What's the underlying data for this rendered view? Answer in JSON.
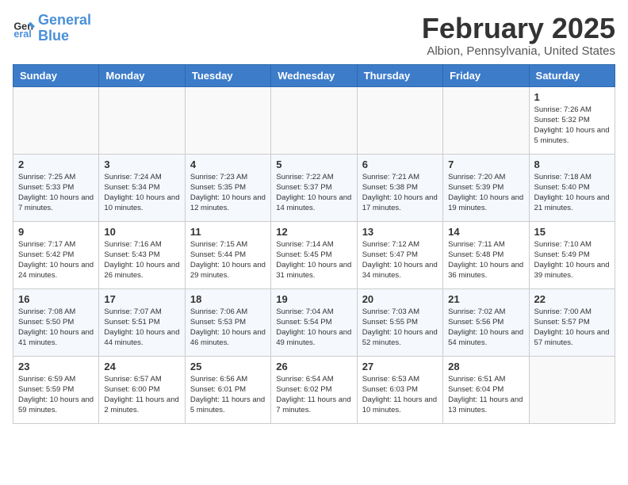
{
  "logo": {
    "line1": "General",
    "line2": "Blue"
  },
  "title": "February 2025",
  "subtitle": "Albion, Pennsylvania, United States",
  "days_of_week": [
    "Sunday",
    "Monday",
    "Tuesday",
    "Wednesday",
    "Thursday",
    "Friday",
    "Saturday"
  ],
  "weeks": [
    [
      {
        "day": "",
        "info": ""
      },
      {
        "day": "",
        "info": ""
      },
      {
        "day": "",
        "info": ""
      },
      {
        "day": "",
        "info": ""
      },
      {
        "day": "",
        "info": ""
      },
      {
        "day": "",
        "info": ""
      },
      {
        "day": "1",
        "info": "Sunrise: 7:26 AM\nSunset: 5:32 PM\nDaylight: 10 hours\nand 5 minutes."
      }
    ],
    [
      {
        "day": "2",
        "info": "Sunrise: 7:25 AM\nSunset: 5:33 PM\nDaylight: 10 hours\nand 7 minutes."
      },
      {
        "day": "3",
        "info": "Sunrise: 7:24 AM\nSunset: 5:34 PM\nDaylight: 10 hours\nand 10 minutes."
      },
      {
        "day": "4",
        "info": "Sunrise: 7:23 AM\nSunset: 5:35 PM\nDaylight: 10 hours\nand 12 minutes."
      },
      {
        "day": "5",
        "info": "Sunrise: 7:22 AM\nSunset: 5:37 PM\nDaylight: 10 hours\nand 14 minutes."
      },
      {
        "day": "6",
        "info": "Sunrise: 7:21 AM\nSunset: 5:38 PM\nDaylight: 10 hours\nand 17 minutes."
      },
      {
        "day": "7",
        "info": "Sunrise: 7:20 AM\nSunset: 5:39 PM\nDaylight: 10 hours\nand 19 minutes."
      },
      {
        "day": "8",
        "info": "Sunrise: 7:18 AM\nSunset: 5:40 PM\nDaylight: 10 hours\nand 21 minutes."
      }
    ],
    [
      {
        "day": "9",
        "info": "Sunrise: 7:17 AM\nSunset: 5:42 PM\nDaylight: 10 hours\nand 24 minutes."
      },
      {
        "day": "10",
        "info": "Sunrise: 7:16 AM\nSunset: 5:43 PM\nDaylight: 10 hours\nand 26 minutes."
      },
      {
        "day": "11",
        "info": "Sunrise: 7:15 AM\nSunset: 5:44 PM\nDaylight: 10 hours\nand 29 minutes."
      },
      {
        "day": "12",
        "info": "Sunrise: 7:14 AM\nSunset: 5:45 PM\nDaylight: 10 hours\nand 31 minutes."
      },
      {
        "day": "13",
        "info": "Sunrise: 7:12 AM\nSunset: 5:47 PM\nDaylight: 10 hours\nand 34 minutes."
      },
      {
        "day": "14",
        "info": "Sunrise: 7:11 AM\nSunset: 5:48 PM\nDaylight: 10 hours\nand 36 minutes."
      },
      {
        "day": "15",
        "info": "Sunrise: 7:10 AM\nSunset: 5:49 PM\nDaylight: 10 hours\nand 39 minutes."
      }
    ],
    [
      {
        "day": "16",
        "info": "Sunrise: 7:08 AM\nSunset: 5:50 PM\nDaylight: 10 hours\nand 41 minutes."
      },
      {
        "day": "17",
        "info": "Sunrise: 7:07 AM\nSunset: 5:51 PM\nDaylight: 10 hours\nand 44 minutes."
      },
      {
        "day": "18",
        "info": "Sunrise: 7:06 AM\nSunset: 5:53 PM\nDaylight: 10 hours\nand 46 minutes."
      },
      {
        "day": "19",
        "info": "Sunrise: 7:04 AM\nSunset: 5:54 PM\nDaylight: 10 hours\nand 49 minutes."
      },
      {
        "day": "20",
        "info": "Sunrise: 7:03 AM\nSunset: 5:55 PM\nDaylight: 10 hours\nand 52 minutes."
      },
      {
        "day": "21",
        "info": "Sunrise: 7:02 AM\nSunset: 5:56 PM\nDaylight: 10 hours\nand 54 minutes."
      },
      {
        "day": "22",
        "info": "Sunrise: 7:00 AM\nSunset: 5:57 PM\nDaylight: 10 hours\nand 57 minutes."
      }
    ],
    [
      {
        "day": "23",
        "info": "Sunrise: 6:59 AM\nSunset: 5:59 PM\nDaylight: 10 hours\nand 59 minutes."
      },
      {
        "day": "24",
        "info": "Sunrise: 6:57 AM\nSunset: 6:00 PM\nDaylight: 11 hours\nand 2 minutes."
      },
      {
        "day": "25",
        "info": "Sunrise: 6:56 AM\nSunset: 6:01 PM\nDaylight: 11 hours\nand 5 minutes."
      },
      {
        "day": "26",
        "info": "Sunrise: 6:54 AM\nSunset: 6:02 PM\nDaylight: 11 hours\nand 7 minutes."
      },
      {
        "day": "27",
        "info": "Sunrise: 6:53 AM\nSunset: 6:03 PM\nDaylight: 11 hours\nand 10 minutes."
      },
      {
        "day": "28",
        "info": "Sunrise: 6:51 AM\nSunset: 6:04 PM\nDaylight: 11 hours\nand 13 minutes."
      },
      {
        "day": "",
        "info": ""
      }
    ]
  ]
}
